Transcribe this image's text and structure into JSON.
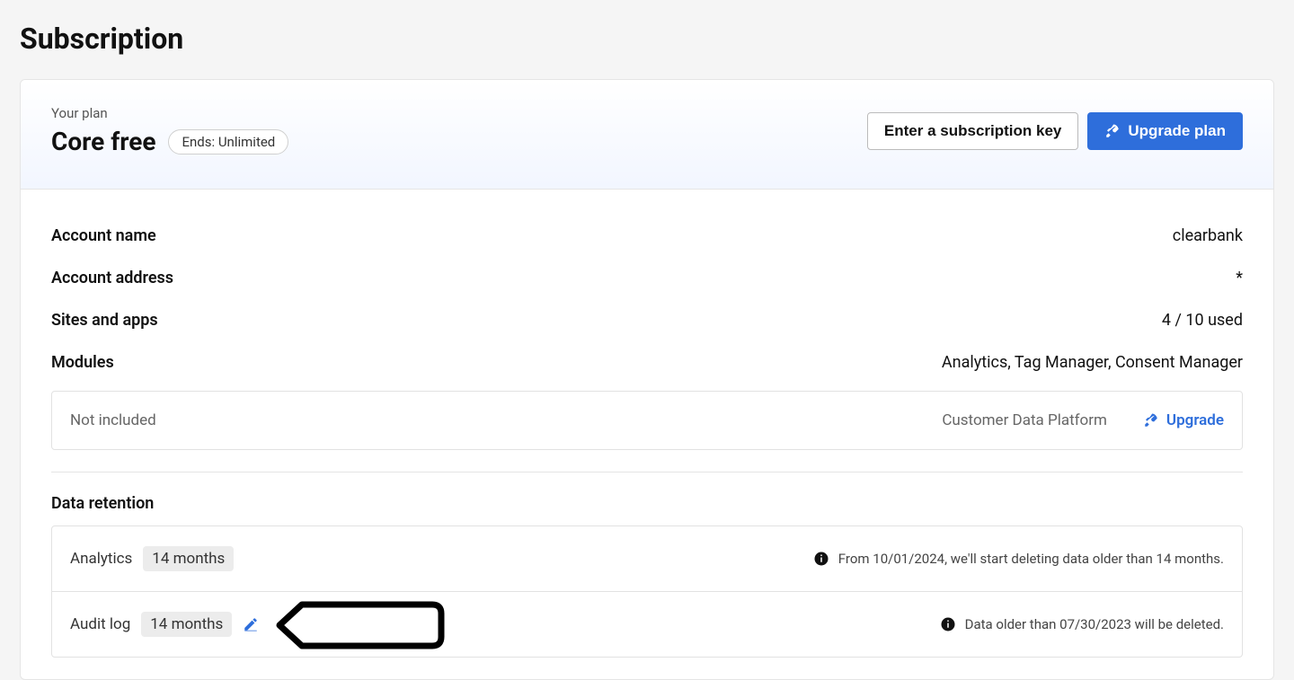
{
  "page": {
    "title": "Subscription"
  },
  "plan": {
    "eyebrow": "Your plan",
    "name": "Core free",
    "ends_badge": "Ends: Unlimited",
    "enter_key_label": "Enter a subscription key",
    "upgrade_label": "Upgrade plan"
  },
  "details": {
    "account_name": {
      "label": "Account name",
      "value": "clearbank"
    },
    "account_address": {
      "label": "Account address",
      "value": "*"
    },
    "sites_apps": {
      "label": "Sites and apps",
      "value": "4 / 10 used"
    },
    "modules": {
      "label": "Modules",
      "value": "Analytics, Tag Manager, Consent Manager"
    }
  },
  "not_included": {
    "label": "Not included",
    "module": "Customer Data Platform",
    "upgrade_label": "Upgrade"
  },
  "retention": {
    "heading": "Data retention",
    "analytics": {
      "name": "Analytics",
      "value": "14 months",
      "note": "From 10/01/2024, we'll start deleting data older than 14 months."
    },
    "audit_log": {
      "name": "Audit log",
      "value": "14 months",
      "note": "Data older than 07/30/2023 will be deleted."
    }
  }
}
